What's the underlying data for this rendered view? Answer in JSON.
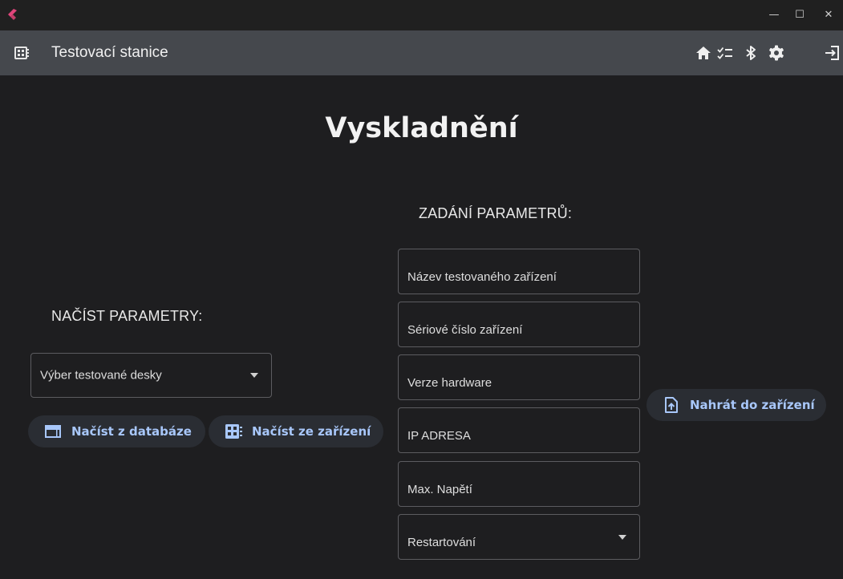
{
  "window": {
    "minimize": "—",
    "maximize": "☐",
    "close": "✕"
  },
  "appbar": {
    "title": "Testovací stanice",
    "icons": [
      "home-icon",
      "checklist-icon",
      "bluetooth-icon",
      "settings-icon",
      "logout-icon"
    ]
  },
  "page": {
    "title": "Vyskladnění"
  },
  "load": {
    "label": "NAČÍST PARAMETRY:",
    "board_select": {
      "placeholder": "Výber testované desky"
    },
    "from_database": "Načíst z databáze",
    "from_device": "Načíst ze zařízení"
  },
  "params": {
    "label": "ZADÁNÍ PARAMETRŮ:",
    "device_name": "Název testovaného zařízení",
    "serial": "Sériové číslo zařízení",
    "hardware": "Verze hardware",
    "ip": "IP ADRESA",
    "max_voltage": "Max. Napětí",
    "restart": "Restartování"
  },
  "upload": {
    "label": "Nahrát do zařízení"
  },
  "colors": {
    "accent": "#a8c7fa",
    "appbar": "#45484d",
    "background": "#1e1e20"
  }
}
